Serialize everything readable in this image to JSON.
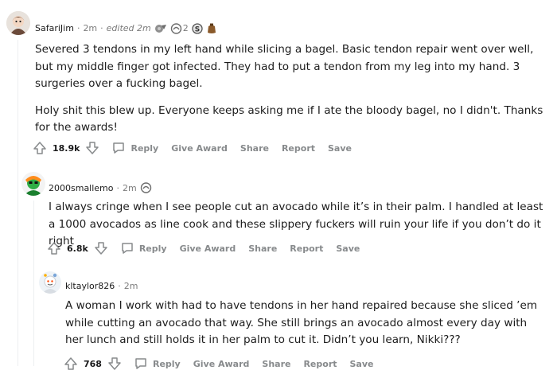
{
  "comments": [
    {
      "username": "SafariJim",
      "time": "2m",
      "edited": "edited 2m",
      "award_count": "2",
      "paragraphs": [
        "Severed 3 tendons in my left hand while slicing a bagel. Basic tendon repair went over well, but my middle finger got infected. They had to put a tendon from my leg into my hand. 3 surgeries over a fucking bagel.",
        "Holy shit this blew up. Everyone keeps asking me if I ate the bloody bagel, no I didn't. Thanks for the awards!"
      ],
      "score": "18.9k"
    },
    {
      "username": "2000smallemo",
      "time": "2m",
      "paragraphs": [
        "I always cringe when I see people cut an avocado while it’s in their palm. I handled at least a 1000 avocados as line cook and these slippery fuckers will ruin your life if you don’t do it right"
      ],
      "score": "6.8k"
    },
    {
      "username": "kltaylor826",
      "time": "2m",
      "paragraphs": [
        "A woman I work with had to have tendons in her hand repaired because she sliced ’em while cutting an avocado that way. She still brings an avocado almost every day with her lunch and still holds it in her palm to cut it. Didn’t you learn, Nikki???"
      ],
      "score": "768"
    }
  ],
  "actions": {
    "reply": "Reply",
    "give_award": "Give Award",
    "share": "Share",
    "report": "Report",
    "save": "Save"
  },
  "meta": {
    "separator": "·"
  },
  "colors": {
    "text": "#1c1c1c",
    "muted": "#878a8c",
    "thread_line": "#edeff1"
  },
  "icons": [
    "avatar-icon",
    "award-icon",
    "upvote-icon",
    "downvote-icon",
    "comment-icon"
  ]
}
